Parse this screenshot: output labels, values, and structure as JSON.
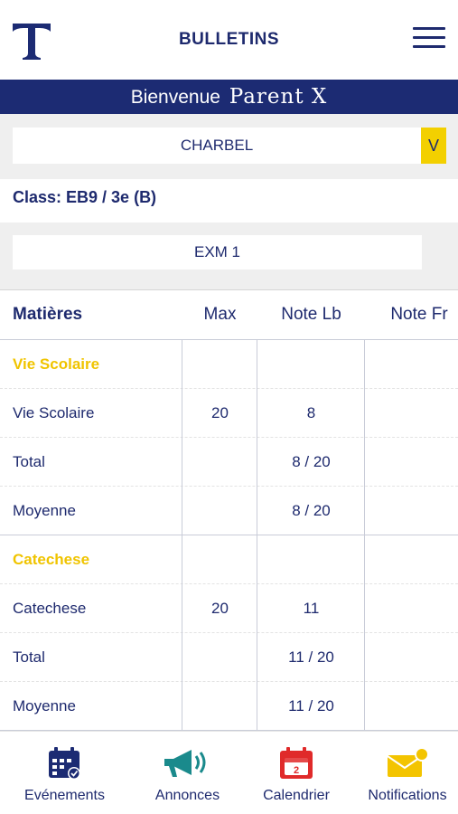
{
  "header": {
    "title": "BULLETINS"
  },
  "welcome": {
    "greeting": "Bienvenue",
    "name": "Parent X"
  },
  "student_select": {
    "value": "CHARBEL",
    "caret": "V"
  },
  "class_info": "Class: EB9 / 3e (B)",
  "exam_select": {
    "value": "EXM 1"
  },
  "table": {
    "headers": [
      "Matières",
      "Max",
      "Note Lb",
      "Note Fr"
    ],
    "rows": [
      {
        "type": "group",
        "name": "Vie Scolaire"
      },
      {
        "type": "row",
        "name": "Vie Scolaire",
        "max": "20",
        "lb": "8"
      },
      {
        "type": "row",
        "name": "Total",
        "max": "",
        "lb": "8 / 20"
      },
      {
        "type": "row",
        "name": "Moyenne",
        "max": "",
        "lb": "8 / 20"
      },
      {
        "type": "group",
        "name": "Catechese"
      },
      {
        "type": "row",
        "name": "Catechese",
        "max": "20",
        "lb": "11"
      },
      {
        "type": "row",
        "name": "Total",
        "max": "",
        "lb": "11 / 20"
      },
      {
        "type": "row",
        "name": "Moyenne",
        "max": "",
        "lb": "11 / 20"
      }
    ]
  },
  "bottom_nav": [
    {
      "label": "Evénements",
      "icon": "calendar-check-icon"
    },
    {
      "label": "Annonces",
      "icon": "megaphone-icon"
    },
    {
      "label": "Calendrier",
      "icon": "calendar-day-icon",
      "badge": "2"
    },
    {
      "label": "Notifications",
      "icon": "envelope-notification-icon"
    }
  ],
  "colors": {
    "navy": "#1c2b73",
    "yellow": "#f3d000",
    "teal": "#1a8a8c",
    "red": "#e02a2a",
    "grey_band": "#efefef"
  }
}
